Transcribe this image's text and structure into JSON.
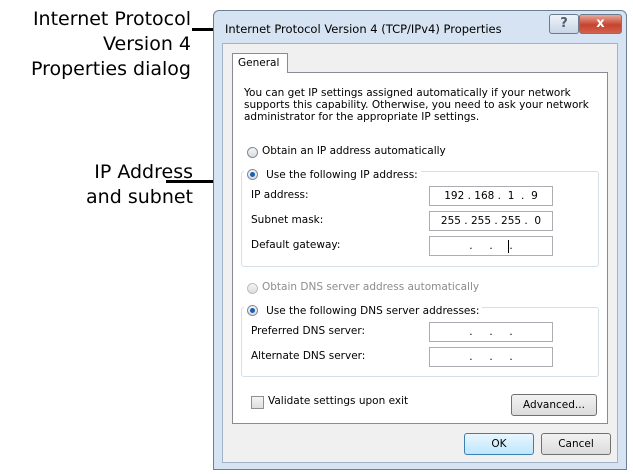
{
  "annotations": {
    "dialog_callout_lines": [
      "Internet Protocol",
      "Version 4",
      "Properties dialog"
    ],
    "ip_callout_lines": [
      "IP Address",
      "and subnet"
    ]
  },
  "dialog": {
    "title": "Internet Protocol Version 4 (TCP/IPv4) Properties",
    "help_glyph": "?",
    "close_glyph": "x",
    "tab_label": "General",
    "description": "You can get IP settings assigned automatically if your network supports this capability. Otherwise, you need to ask your network administrator for the appropriate IP settings.",
    "ip_mode": {
      "auto_label": "Obtain an IP address automatically",
      "manual_label": "Use the following IP address:",
      "selected": "manual"
    },
    "ip_fields": [
      {
        "label": "IP address:",
        "value": "192 . 168 .  1  .  9"
      },
      {
        "label": "Subnet mask:",
        "value": "255 . 255 . 255 .  0"
      },
      {
        "label": "Default gateway:",
        "value": "   .     .     .   "
      }
    ],
    "dns_mode": {
      "auto_label": "Obtain DNS server address automatically",
      "manual_label": "Use the following DNS server addresses:",
      "selected": "manual"
    },
    "dns_fields": [
      {
        "label": "Preferred DNS server:",
        "value": "   .     .     .   "
      },
      {
        "label": "Alternate DNS server:",
        "value": "   .     .     .   "
      }
    ],
    "validate_label": "Validate settings upon exit",
    "validate_checked": false,
    "advanced_label": "Advanced...",
    "ok_label": "OK",
    "cancel_label": "Cancel"
  }
}
